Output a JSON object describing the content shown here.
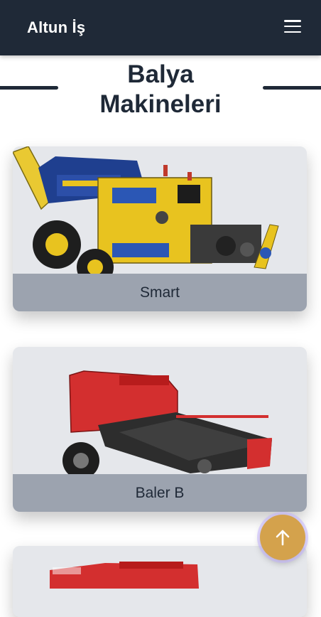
{
  "navbar": {
    "brand": "Altun İş",
    "menu_icon": "hamburger-icon"
  },
  "section": {
    "title_line1": "Balya",
    "title_line2": "Makineleri"
  },
  "products": [
    {
      "name": "Smart",
      "image_icon": "baler-machine-yellow"
    },
    {
      "name": "Baler B",
      "image_icon": "baler-machine-red"
    },
    {
      "name": "",
      "image_icon": "baler-machine-red-partial"
    }
  ],
  "scroll_top": {
    "icon": "arrow-up-icon"
  },
  "colors": {
    "navbar": "#1f2937",
    "caption_bar": "#9ca3af",
    "card_bg": "#e5e7eb",
    "fab": "#d4a24c",
    "machine_yellow": "#e8c31f",
    "machine_red": "#d32f2f"
  }
}
